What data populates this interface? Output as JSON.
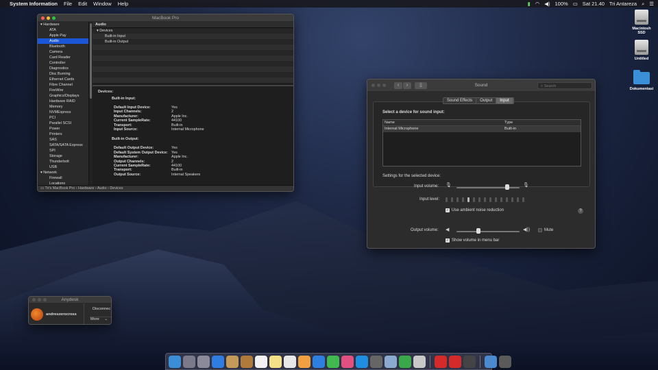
{
  "menubar": {
    "app": "System Information",
    "items": [
      "File",
      "Edit",
      "Window",
      "Help"
    ],
    "battery": "100%",
    "clock": "Sat 21.40",
    "user": "Tri Antareza"
  },
  "desktop": [
    {
      "label": "Macintosh SSD"
    },
    {
      "label": "Untitled"
    },
    {
      "label": "Dokumentasi"
    }
  ],
  "sysinfo": {
    "title": "MacBook Pro",
    "sidebar": [
      {
        "label": "Hardware",
        "group": true
      },
      {
        "label": "ATA"
      },
      {
        "label": "Apple Pay"
      },
      {
        "label": "Audio",
        "selected": true
      },
      {
        "label": "Bluetooth"
      },
      {
        "label": "Camera"
      },
      {
        "label": "Card Reader"
      },
      {
        "label": "Controller"
      },
      {
        "label": "Diagnostics"
      },
      {
        "label": "Disc Burning"
      },
      {
        "label": "Ethernet Cards"
      },
      {
        "label": "Fibre Channel"
      },
      {
        "label": "FireWire"
      },
      {
        "label": "Graphics/Displays"
      },
      {
        "label": "Hardware RAID"
      },
      {
        "label": "Memory"
      },
      {
        "label": "NVMExpress"
      },
      {
        "label": "PCI"
      },
      {
        "label": "Parallel SCSI"
      },
      {
        "label": "Power"
      },
      {
        "label": "Printers"
      },
      {
        "label": "SAS"
      },
      {
        "label": "SATA/SATA Express"
      },
      {
        "label": "SPI"
      },
      {
        "label": "Storage"
      },
      {
        "label": "Thunderbolt"
      },
      {
        "label": "USB"
      },
      {
        "label": "Network",
        "group": true
      },
      {
        "label": "Firewall"
      },
      {
        "label": "Locations"
      }
    ],
    "header": "Audio",
    "tree": [
      "Devices",
      "Built-in Input",
      "Built-in Output"
    ],
    "detail": {
      "devices_label": "Devices:",
      "input_title": "Built-in Input:",
      "input": [
        [
          "Default Input Device:",
          "Yes"
        ],
        [
          "Input Channels:",
          "2"
        ],
        [
          "Manufacturer:",
          "Apple Inc."
        ],
        [
          "Current SampleRate:",
          "44100"
        ],
        [
          "Transport:",
          "Built-in"
        ],
        [
          "Input Source:",
          "Internal Microphone"
        ]
      ],
      "output_title": "Built-in Output:",
      "output": [
        [
          "Default Output Device:",
          "Yes"
        ],
        [
          "Default System Output Device:",
          "Yes"
        ],
        [
          "Manufacturer:",
          "Apple Inc."
        ],
        [
          "Output Channels:",
          "2"
        ],
        [
          "Current SampleRate:",
          "44100"
        ],
        [
          "Transport:",
          "Built-in"
        ],
        [
          "Output Source:",
          "Internal Speakers"
        ]
      ]
    },
    "status": "Tri's MacBook Pro › Hardware › Audio › Devices"
  },
  "sound": {
    "title": "Sound",
    "search_placeholder": "Search",
    "tabs": [
      "Sound Effects",
      "Output",
      "Input"
    ],
    "active_tab": "Input",
    "select_label": "Select a device for sound input:",
    "columns": [
      "Name",
      "Type"
    ],
    "rows": [
      [
        "Internal Microphone",
        "Built-in"
      ]
    ],
    "settings_label": "Settings for the selected device:",
    "input_volume_label": "Input volume:",
    "input_volume": 0.8,
    "input_level_label": "Input level:",
    "input_level": 0.3,
    "ambient_label": "Use ambient noise reduction",
    "ambient_checked": true,
    "output_volume_label": "Output volume:",
    "output_volume": 0.35,
    "mute_label": "Mute",
    "mute_checked": false,
    "show_volume_label": "Show volume in menu bar",
    "show_volume_checked": true
  },
  "anydesk": {
    "title": "Anydesk",
    "user": "andreszerocross",
    "disconnect": "Disconnec",
    "more": "More"
  },
  "dock": {
    "colors": [
      "#3b8ed6",
      "#7a7a8a",
      "#8a8a9a",
      "#2f7de0",
      "#c49a5a",
      "#b07a3a",
      "#f2f2f2",
      "#f5e08a",
      "#e8e8e8",
      "#f0a040",
      "#2d7fe0",
      "#3fb950",
      "#e05080",
      "#1e8fe0",
      "#666",
      "#8aaad0",
      "#3aa84a",
      "#c8c8c8",
      "#d42a2a",
      "#d42a2a",
      "#444",
      "#4a8ad0",
      "#5a5a5a"
    ]
  }
}
